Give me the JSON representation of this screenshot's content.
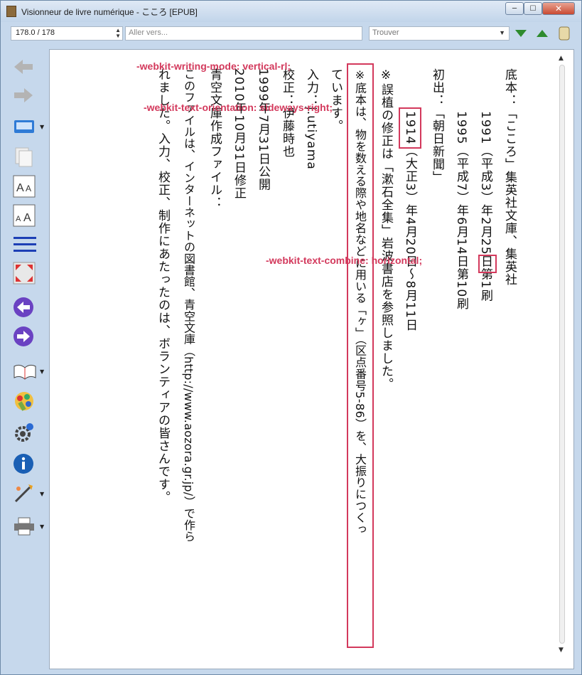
{
  "window": {
    "title": "Visionneur de livre numérique - こころ [EPUB]",
    "controls": {
      "minimize": "─",
      "maximize": "☐",
      "close": "✕"
    }
  },
  "toolbar": {
    "page_value": "178.0 / 178",
    "goto_placeholder": "Aller vers...",
    "find_placeholder": "Trouver",
    "icons": [
      "find-next-icon",
      "find-previous-icon",
      "scroll-icon"
    ]
  },
  "sidebar": {
    "items": [
      "back-icon",
      "forward-icon",
      "view-mode-icon",
      "copy-icon",
      "font-increase-icon",
      "font-decrease-icon",
      "toc-icon",
      "fullscreen-icon",
      "previous-page-icon",
      "next-page-icon",
      "library-icon",
      "theme-icon",
      "preferences-icon",
      "info-icon",
      "tweak-icon",
      "print-icon"
    ]
  },
  "book": {
    "columns": [
      "底本：「こころ」集英社文庫、集英社",
      "1991（平成3）年2月25日第1刷",
      "1995（平成7）年6月14日第10刷",
      "初出：「朝日新聞」",
      "1914（大正3）年4月20日～8月11日",
      "※誤植の修正は「漱石全集」岩波書店を参照しました。",
      "※底本は、物を数える際や地名などに用いる「ヶ」（区点番号5-86）を、大振りにつくっ",
      "ています。",
      "入力：j.utiyama",
      "校正：伊藤時也",
      "1999年7月31日公開",
      "2010年10月31日修正",
      "青空文庫作成ファイル：",
      "このファイルは、インターネットの図書館、青空文庫（http://www.aozora.gr.jp/）で作ら",
      "れました。入力、校正、制作にあたったのは、ボランティアの皆さんです。"
    ],
    "annotations": {
      "writing_mode": "-webkit-writing-mode:  vertical-rl;",
      "text_orientation": "-webkit-text-orientation:  sideways-right;",
      "text_combine": "-webkit-text-combine:  horizontal;"
    }
  },
  "colors": {
    "annotation": "#d3395c",
    "accent_green": "#2e8b2e",
    "accent_blue": "#1d3fb5"
  }
}
